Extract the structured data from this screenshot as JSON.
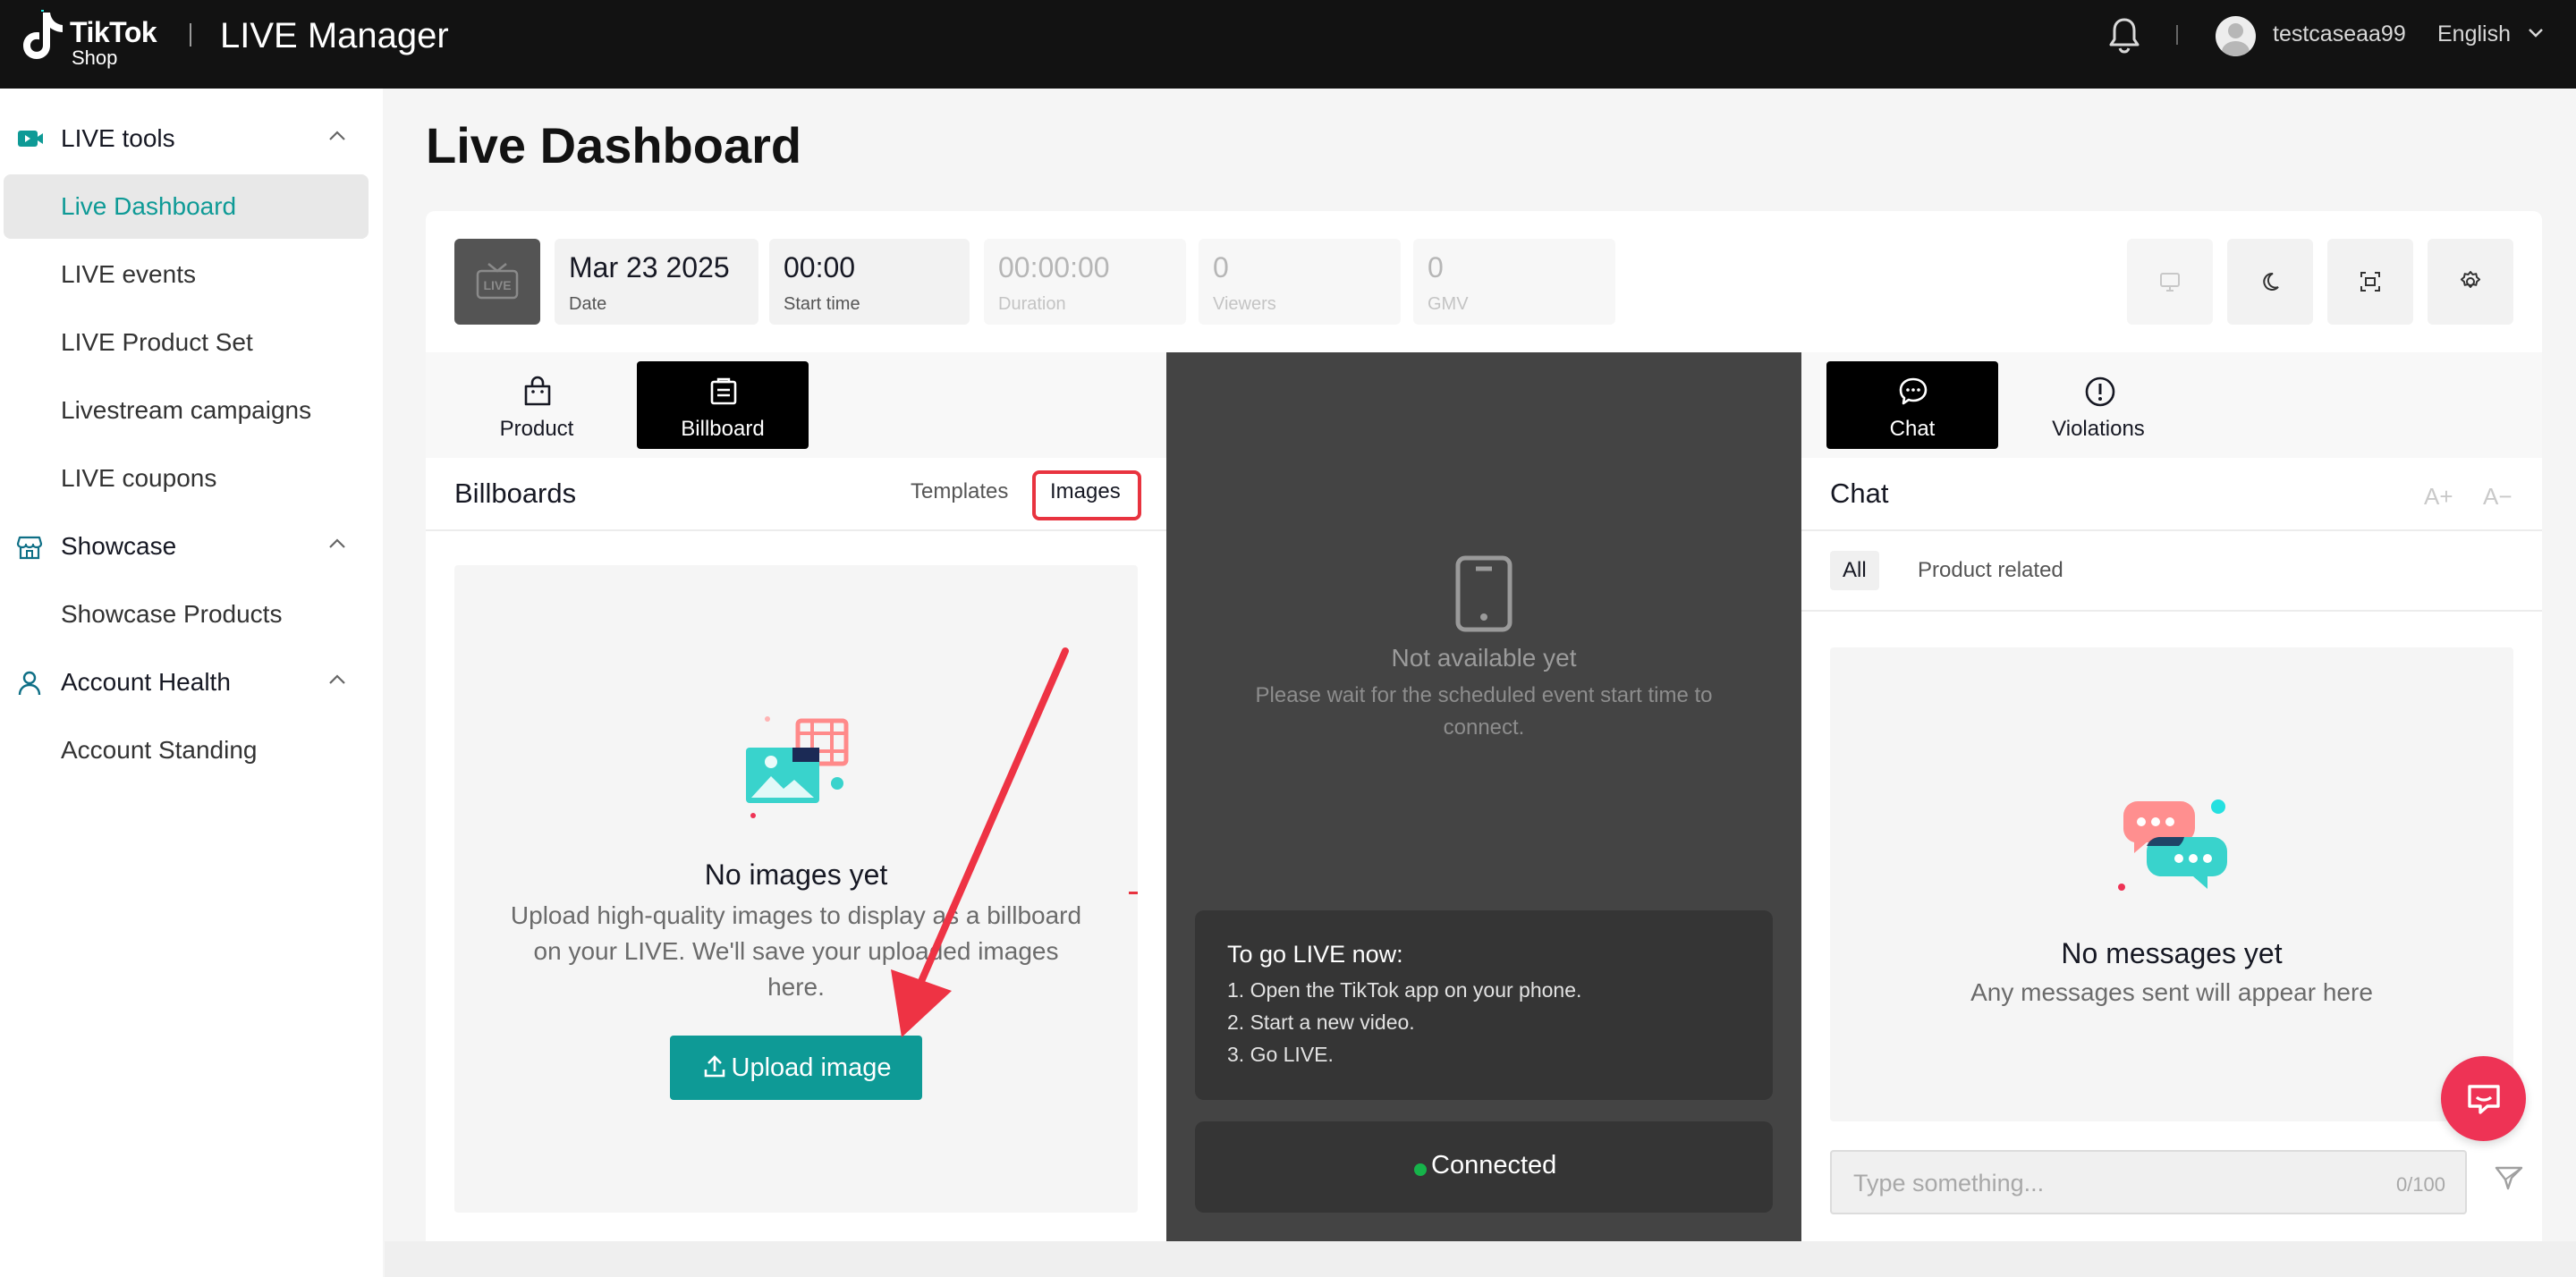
{
  "header": {
    "logo_line1": "TikTok",
    "logo_line2": "Shop",
    "app_title": "LIVE Manager",
    "username": "testcaseaa99",
    "language": "English"
  },
  "sidebar": {
    "groups": [
      {
        "label": "LIVE tools",
        "icon": "video-camera-icon",
        "items": [
          "Live Dashboard",
          "LIVE events",
          "LIVE Product Set",
          "Livestream campaigns",
          "LIVE coupons"
        ]
      },
      {
        "label": "Showcase",
        "icon": "storefront-icon",
        "items": [
          "Showcase Products"
        ]
      },
      {
        "label": "Account Health",
        "icon": "person-icon",
        "items": [
          "Account Standing"
        ]
      }
    ],
    "active_item": "Live Dashboard"
  },
  "page": {
    "title": "Live Dashboard"
  },
  "stats": {
    "date": {
      "value": "Mar 23 2025",
      "label": "Date"
    },
    "start_time": {
      "value": "00:00",
      "label": "Start time"
    },
    "duration": {
      "value": "00:00:00",
      "label": "Duration"
    },
    "viewers": {
      "value": "0",
      "label": "Viewers"
    },
    "gmv": {
      "value": "0",
      "label": "GMV"
    }
  },
  "left_panel": {
    "tabs": [
      {
        "label": "Product",
        "icon": "shopping-bag-icon"
      },
      {
        "label": "Billboard",
        "icon": "billboard-icon",
        "active": true
      }
    ],
    "section_title": "Billboards",
    "subtabs": [
      "Templates",
      "Images"
    ],
    "selected_subtab": "Images",
    "empty_title": "No images yet",
    "empty_desc": "Upload high-quality images to display as a billboard on your LIVE. We'll save your uploaded images here.",
    "upload_label": "Upload image"
  },
  "middle_panel": {
    "status_title": "Not available yet",
    "status_desc": "Please wait for the scheduled event start time to connect.",
    "go_live_title": "To go LIVE now:",
    "go_live_steps": [
      "1. Open the TikTok app on your phone.",
      "2. Start a new video.",
      "3. Go LIVE."
    ],
    "connection_status": "Connected"
  },
  "right_panel": {
    "tabs": [
      {
        "label": "Chat",
        "icon": "chat-bubble-icon",
        "active": true
      },
      {
        "label": "Violations",
        "icon": "alert-circle-icon"
      }
    ],
    "section_title": "Chat",
    "font_increase": "A+",
    "font_decrease": "A−",
    "filters": [
      "All",
      "Product related"
    ],
    "selected_filter": "All",
    "empty_title": "No messages yet",
    "empty_desc": "Any messages sent will appear here",
    "input_placeholder": "Type something...",
    "char_count": "0/100"
  },
  "colors": {
    "accent": "#0e9a96",
    "topbar": "#121212",
    "highlight": "#e8333f",
    "fab": "#ee3355",
    "connected": "#16b34a"
  }
}
